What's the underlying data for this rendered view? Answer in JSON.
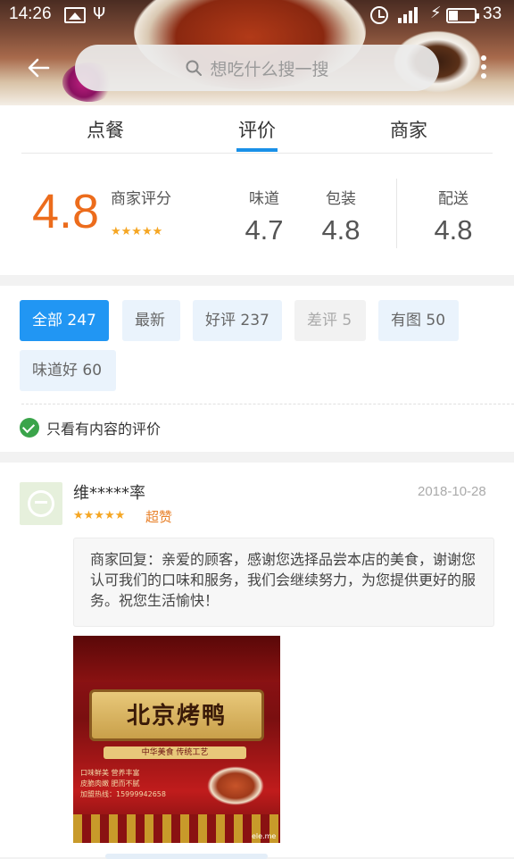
{
  "status_bar": {
    "time": "14:26",
    "battery": "33"
  },
  "search": {
    "placeholder": "想吃什么搜一搜"
  },
  "tabs": [
    {
      "label": "点餐",
      "active": false
    },
    {
      "label": "评价",
      "active": true
    },
    {
      "label": "商家",
      "active": false
    }
  ],
  "rating": {
    "score": "4.8",
    "score_label": "商家评分",
    "stars": "★★★★★",
    "columns": [
      {
        "label": "味道",
        "value": "4.7"
      },
      {
        "label": "包装",
        "value": "4.8"
      },
      {
        "label": "配送",
        "value": "4.8"
      }
    ]
  },
  "filters": {
    "chips": [
      {
        "label": "全部 247",
        "state": "active"
      },
      {
        "label": "最新",
        "state": "normal"
      },
      {
        "label": "好评 237",
        "state": "normal"
      },
      {
        "label": "差评 5",
        "state": "disabled"
      },
      {
        "label": "有图 50",
        "state": "normal"
      },
      {
        "label": "味道好 60",
        "state": "normal"
      }
    ],
    "only_content": "只看有内容的评价"
  },
  "review": {
    "user": "维*****率",
    "date": "2018-10-28",
    "stars": "★★★★★",
    "tag": "超赞",
    "reply": "商家回复：亲爱的顾客，感谢您选择品尝本店的美食，谢谢您认可我们的口味和服务，我们会继续努力，为您提供更好的服务。祝您生活愉快！",
    "photo": {
      "title": "北京烤鸭",
      "subtitle": "中华美食 传统工艺",
      "lines": [
        "口味鲜美  营养丰富",
        "皮脆肉嫩  肥而不腻",
        "加盟热线：15999942658"
      ],
      "watermark": "ele.me"
    }
  },
  "colors": {
    "accent": "#2196f3",
    "score": "#ec6c1c",
    "stars": "#f5a623",
    "check": "#3aa44a"
  }
}
